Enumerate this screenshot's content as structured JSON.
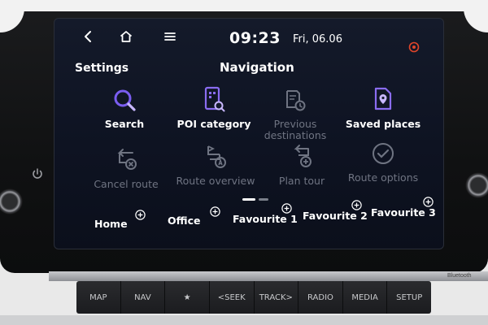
{
  "status": {
    "time": "09:23",
    "date": "Fri, 06.06"
  },
  "header": {
    "settings_label": "Settings",
    "title": "Navigation"
  },
  "tiles": [
    {
      "label": "Search",
      "icon": "search-icon",
      "enabled": true
    },
    {
      "label": "POI category",
      "icon": "poi-category-icon",
      "enabled": true
    },
    {
      "label": "Previous destinations",
      "icon": "previous-destinations-icon",
      "enabled": false
    },
    {
      "label": "Saved places",
      "icon": "saved-places-icon",
      "enabled": true
    },
    {
      "label": "Cancel route",
      "icon": "cancel-route-icon",
      "enabled": false
    },
    {
      "label": "Route overview",
      "icon": "route-overview-icon",
      "enabled": false
    },
    {
      "label": "Plan tour",
      "icon": "plan-tour-icon",
      "enabled": false
    },
    {
      "label": "Route options",
      "icon": "route-options-icon",
      "enabled": false
    }
  ],
  "favourites": [
    "Home",
    "Office",
    "Favourite 1",
    "Favourite 2",
    "Favourite 3"
  ],
  "hardware_keys": [
    "MAP",
    "NAV",
    "★",
    "<SEEK",
    "TRACK>",
    "RADIO",
    "MEDIA",
    "SETUP"
  ],
  "hardware_brand": "Bluetooth",
  "colors": {
    "accent": "#8a6cf0",
    "icon_primary": "#7a5df0",
    "disabled_text": "#6f7482"
  }
}
